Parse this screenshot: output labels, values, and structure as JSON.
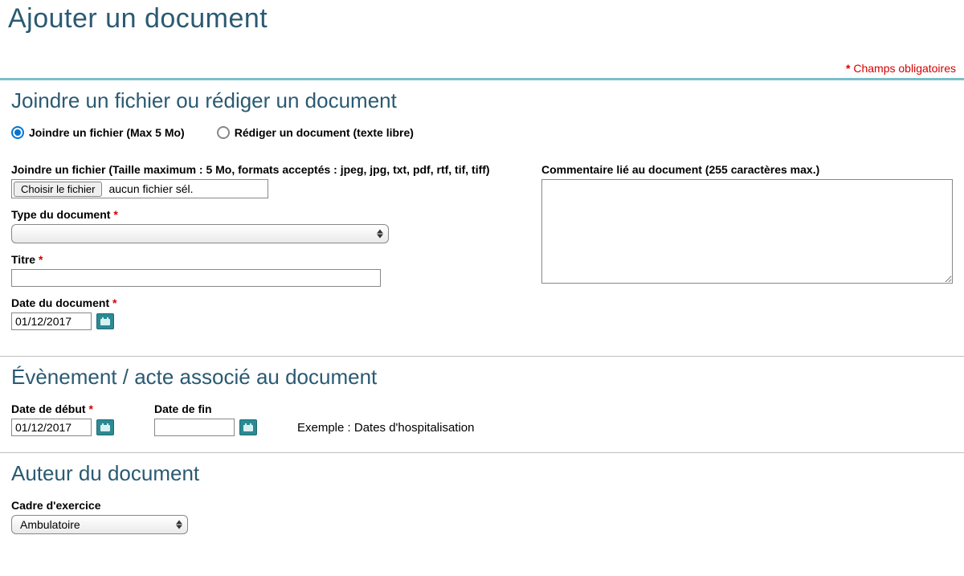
{
  "page": {
    "title": "Ajouter un document",
    "required_note": "Champs obligatoires"
  },
  "attach": {
    "section_title": "Joindre un fichier ou rédiger un document",
    "radio_attach": "Joindre un fichier (Max 5 Mo)",
    "radio_write": "Rédiger un document (texte libre)",
    "file_label": "Joindre un fichier (Taille maximum : 5 Mo, formats acceptés : jpeg, jpg, txt, pdf, rtf, tif, tiff)",
    "choose_button": "Choisir le fichier",
    "file_status": "aucun fichier sél.",
    "doc_type_label": "Type du document",
    "doc_type_value": "",
    "title_label": "Titre",
    "title_value": "",
    "doc_date_label": "Date du document",
    "doc_date_value": "01/12/2017",
    "comment_label": "Commentaire lié au document (255 caractères max.)",
    "comment_value": ""
  },
  "event": {
    "section_title": "Évènement / acte associé au document",
    "start_label": "Date de début",
    "start_value": "01/12/2017",
    "end_label": "Date de fin",
    "end_value": "",
    "example": "Exemple : Dates d'hospitalisation"
  },
  "author": {
    "section_title": "Auteur du document",
    "setting_label": "Cadre d'exercice",
    "setting_value": "Ambulatoire"
  }
}
